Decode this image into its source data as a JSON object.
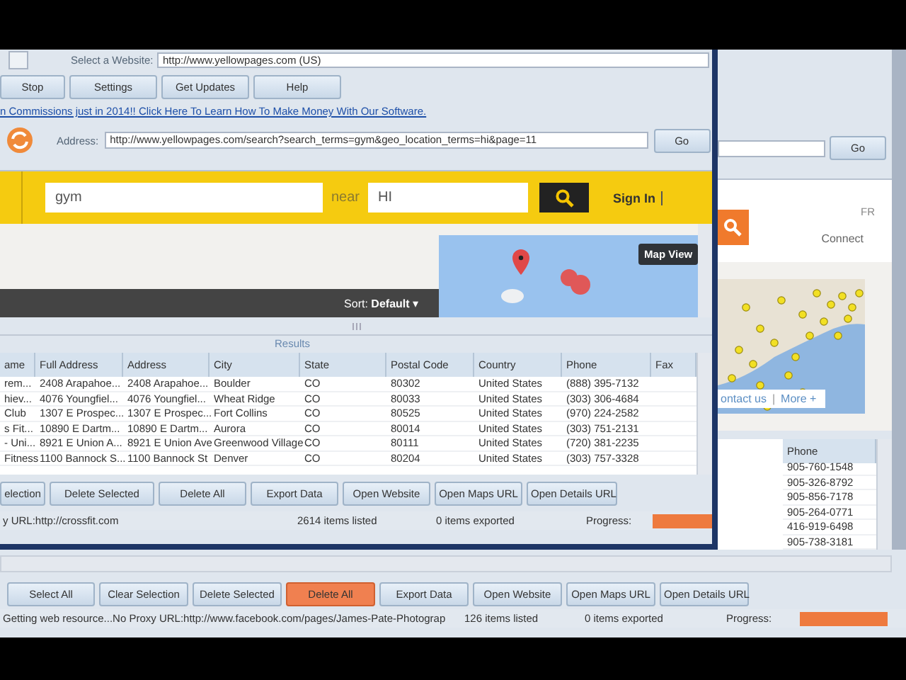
{
  "front_window": {
    "website_label": "Select a Website:",
    "website_value": "http://www.yellowpages.com (US)",
    "toolbar_buttons": [
      "Stop",
      "Settings",
      "Get Updates",
      "Help"
    ],
    "promo_link": "n Commissions just in 2014!! Click Here To Learn How To Make Money With Our Software.",
    "address_label": "Address:",
    "address_value": "http://www.yellowpages.com/search?search_terms=gym&geo_location_terms=hi&page=11",
    "go_button": "Go",
    "web_view": {
      "search_value": "gym",
      "near_label": "near",
      "location_value": "HI",
      "sign_in": "Sign In",
      "sort_label": "Sort:",
      "sort_value": "Default",
      "sort_caret": "▾",
      "map_view_button": "Map View"
    },
    "results_title": "Results",
    "table": {
      "columns": [
        "ame",
        "Full Address",
        "Address",
        "City",
        "State",
        "Postal Code",
        "Country",
        "Phone",
        "Fax"
      ],
      "rows": [
        [
          "rem...",
          "2408 Arapahoe...",
          "2408 Arapahoe...",
          "Boulder",
          "CO",
          "80302",
          "United States",
          "(888) 395-7132",
          ""
        ],
        [
          "hiev...",
          "4076 Youngfiel...",
          "4076 Youngfiel...",
          "Wheat Ridge",
          "CO",
          "80033",
          "United States",
          "(303) 306-4684",
          ""
        ],
        [
          "Club",
          "1307 E Prospec...",
          "1307 E Prospec...",
          "Fort Collins",
          "CO",
          "80525",
          "United States",
          "(970) 224-2582",
          ""
        ],
        [
          "s Fit...",
          "10890 E Dartm...",
          "10890 E Dartm...",
          "Aurora",
          "CO",
          "80014",
          "United States",
          "(303) 751-2131",
          ""
        ],
        [
          "- Uni...",
          "8921 E Union A...",
          "8921 E Union Ave",
          "Greenwood Village",
          "CO",
          "80111",
          "United States",
          "(720) 381-2235",
          ""
        ],
        [
          "Fitness",
          "1100 Bannock S...",
          "1100 Bannock St",
          "Denver",
          "CO",
          "80204",
          "United States",
          "(303) 757-3328",
          ""
        ]
      ]
    },
    "buttons": [
      "election",
      "Delete Selected",
      "Delete All",
      "Export Data",
      "Open Website",
      "Open Maps URL",
      "Open Details URL"
    ],
    "status": {
      "message": "y URL:http://crossfit.com",
      "listed": "2614 items listed",
      "exported": "0 items exported",
      "progress_label": "Progress:",
      "level": 1
    }
  },
  "back_window": {
    "go_button": "Go",
    "web_view": {
      "language": "FR",
      "connect": "Connect",
      "contact_link": "ontact us",
      "separator": "|",
      "more_link": "More +"
    },
    "table": {
      "columns": [
        "Phone"
      ],
      "rows": [
        [
          "905-760-1548"
        ],
        [
          "905-326-8792"
        ],
        [
          "905-856-7178"
        ],
        [
          "905-264-0771"
        ],
        [
          "416-919-6498"
        ],
        [
          "905-738-3181"
        ]
      ]
    },
    "buttons": [
      {
        "label": "Select All",
        "kind": "normal"
      },
      {
        "label": "Clear Selection",
        "kind": "normal"
      },
      {
        "label": "Delete Selected",
        "kind": "normal"
      },
      {
        "label": "Delete All",
        "kind": "danger"
      },
      {
        "label": "Export Data",
        "kind": "normal"
      },
      {
        "label": "Open Website",
        "kind": "normal"
      },
      {
        "label": "Open Maps URL",
        "kind": "normal"
      },
      {
        "label": "Open Details URL",
        "kind": "normal"
      }
    ],
    "status": {
      "message": "Getting web resource...No Proxy URL:http://www.facebook.com/pages/James-Pate-Photograp",
      "listed": "126 items listed",
      "exported": "0 items exported",
      "progress_label": "Progress:",
      "level": 1
    }
  }
}
